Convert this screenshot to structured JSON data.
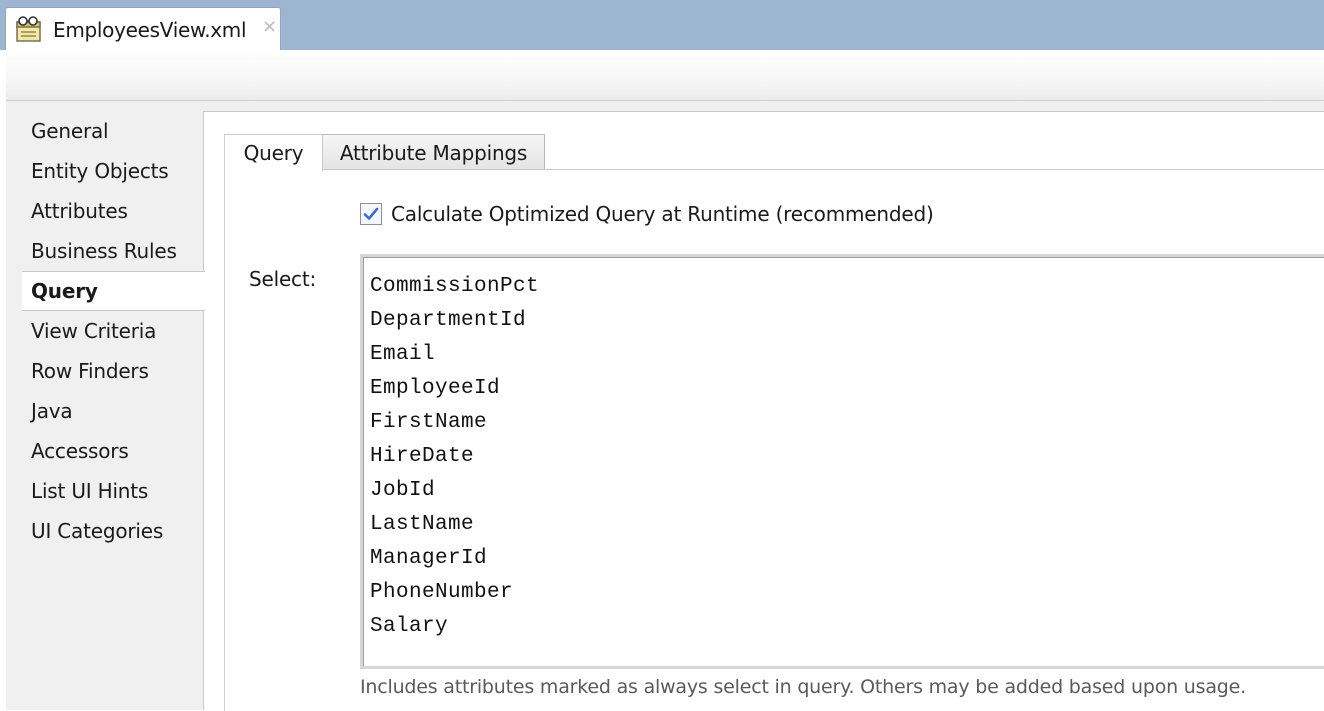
{
  "file_tab": {
    "label": "EmployeesView.xml",
    "close": "×"
  },
  "nav": {
    "items": [
      {
        "label": "General"
      },
      {
        "label": "Entity Objects"
      },
      {
        "label": "Attributes"
      },
      {
        "label": "Business Rules"
      },
      {
        "label": "Query",
        "selected": true
      },
      {
        "label": "View Criteria"
      },
      {
        "label": "Row Finders"
      },
      {
        "label": "Java"
      },
      {
        "label": "Accessors"
      },
      {
        "label": "List UI Hints"
      },
      {
        "label": "UI Categories"
      }
    ]
  },
  "subtabs": {
    "query": "Query",
    "mappings": "Attribute Mappings"
  },
  "optimized": {
    "label": "Calculate Optimized Query at Runtime (recommended)",
    "checked": true
  },
  "select": {
    "label": "Select:",
    "columns": [
      "CommissionPct",
      "DepartmentId",
      "Email",
      "EmployeeId",
      "FirstName",
      "HireDate",
      "JobId",
      "LastName",
      "ManagerId",
      "PhoneNumber",
      "Salary"
    ]
  },
  "hint": "Includes attributes marked as always select in query.  Others may be added based upon usage.",
  "colors": {
    "tabstrip": "#9db5d1",
    "checkmark": "#3a6ccf"
  },
  "icons": {
    "file_tab": "xml-view-object-icon",
    "checkbox": "checkmark-icon"
  }
}
